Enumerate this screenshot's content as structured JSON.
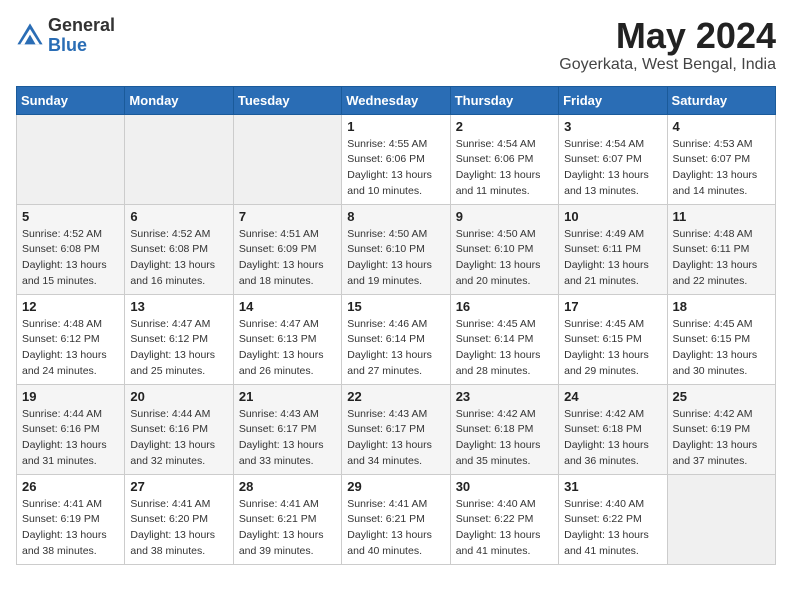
{
  "header": {
    "logo_general": "General",
    "logo_blue": "Blue",
    "month_year": "May 2024",
    "location": "Goyerkata, West Bengal, India"
  },
  "days_of_week": [
    "Sunday",
    "Monday",
    "Tuesday",
    "Wednesday",
    "Thursday",
    "Friday",
    "Saturday"
  ],
  "weeks": [
    {
      "days": [
        {
          "number": "",
          "sunrise": "",
          "sunset": "",
          "daylight": ""
        },
        {
          "number": "",
          "sunrise": "",
          "sunset": "",
          "daylight": ""
        },
        {
          "number": "",
          "sunrise": "",
          "sunset": "",
          "daylight": ""
        },
        {
          "number": "1",
          "sunrise": "Sunrise: 4:55 AM",
          "sunset": "Sunset: 6:06 PM",
          "daylight": "Daylight: 13 hours and 10 minutes."
        },
        {
          "number": "2",
          "sunrise": "Sunrise: 4:54 AM",
          "sunset": "Sunset: 6:06 PM",
          "daylight": "Daylight: 13 hours and 11 minutes."
        },
        {
          "number": "3",
          "sunrise": "Sunrise: 4:54 AM",
          "sunset": "Sunset: 6:07 PM",
          "daylight": "Daylight: 13 hours and 13 minutes."
        },
        {
          "number": "4",
          "sunrise": "Sunrise: 4:53 AM",
          "sunset": "Sunset: 6:07 PM",
          "daylight": "Daylight: 13 hours and 14 minutes."
        }
      ]
    },
    {
      "days": [
        {
          "number": "5",
          "sunrise": "Sunrise: 4:52 AM",
          "sunset": "Sunset: 6:08 PM",
          "daylight": "Daylight: 13 hours and 15 minutes."
        },
        {
          "number": "6",
          "sunrise": "Sunrise: 4:52 AM",
          "sunset": "Sunset: 6:08 PM",
          "daylight": "Daylight: 13 hours and 16 minutes."
        },
        {
          "number": "7",
          "sunrise": "Sunrise: 4:51 AM",
          "sunset": "Sunset: 6:09 PM",
          "daylight": "Daylight: 13 hours and 18 minutes."
        },
        {
          "number": "8",
          "sunrise": "Sunrise: 4:50 AM",
          "sunset": "Sunset: 6:10 PM",
          "daylight": "Daylight: 13 hours and 19 minutes."
        },
        {
          "number": "9",
          "sunrise": "Sunrise: 4:50 AM",
          "sunset": "Sunset: 6:10 PM",
          "daylight": "Daylight: 13 hours and 20 minutes."
        },
        {
          "number": "10",
          "sunrise": "Sunrise: 4:49 AM",
          "sunset": "Sunset: 6:11 PM",
          "daylight": "Daylight: 13 hours and 21 minutes."
        },
        {
          "number": "11",
          "sunrise": "Sunrise: 4:48 AM",
          "sunset": "Sunset: 6:11 PM",
          "daylight": "Daylight: 13 hours and 22 minutes."
        }
      ]
    },
    {
      "days": [
        {
          "number": "12",
          "sunrise": "Sunrise: 4:48 AM",
          "sunset": "Sunset: 6:12 PM",
          "daylight": "Daylight: 13 hours and 24 minutes."
        },
        {
          "number": "13",
          "sunrise": "Sunrise: 4:47 AM",
          "sunset": "Sunset: 6:12 PM",
          "daylight": "Daylight: 13 hours and 25 minutes."
        },
        {
          "number": "14",
          "sunrise": "Sunrise: 4:47 AM",
          "sunset": "Sunset: 6:13 PM",
          "daylight": "Daylight: 13 hours and 26 minutes."
        },
        {
          "number": "15",
          "sunrise": "Sunrise: 4:46 AM",
          "sunset": "Sunset: 6:14 PM",
          "daylight": "Daylight: 13 hours and 27 minutes."
        },
        {
          "number": "16",
          "sunrise": "Sunrise: 4:45 AM",
          "sunset": "Sunset: 6:14 PM",
          "daylight": "Daylight: 13 hours and 28 minutes."
        },
        {
          "number": "17",
          "sunrise": "Sunrise: 4:45 AM",
          "sunset": "Sunset: 6:15 PM",
          "daylight": "Daylight: 13 hours and 29 minutes."
        },
        {
          "number": "18",
          "sunrise": "Sunrise: 4:45 AM",
          "sunset": "Sunset: 6:15 PM",
          "daylight": "Daylight: 13 hours and 30 minutes."
        }
      ]
    },
    {
      "days": [
        {
          "number": "19",
          "sunrise": "Sunrise: 4:44 AM",
          "sunset": "Sunset: 6:16 PM",
          "daylight": "Daylight: 13 hours and 31 minutes."
        },
        {
          "number": "20",
          "sunrise": "Sunrise: 4:44 AM",
          "sunset": "Sunset: 6:16 PM",
          "daylight": "Daylight: 13 hours and 32 minutes."
        },
        {
          "number": "21",
          "sunrise": "Sunrise: 4:43 AM",
          "sunset": "Sunset: 6:17 PM",
          "daylight": "Daylight: 13 hours and 33 minutes."
        },
        {
          "number": "22",
          "sunrise": "Sunrise: 4:43 AM",
          "sunset": "Sunset: 6:17 PM",
          "daylight": "Daylight: 13 hours and 34 minutes."
        },
        {
          "number": "23",
          "sunrise": "Sunrise: 4:42 AM",
          "sunset": "Sunset: 6:18 PM",
          "daylight": "Daylight: 13 hours and 35 minutes."
        },
        {
          "number": "24",
          "sunrise": "Sunrise: 4:42 AM",
          "sunset": "Sunset: 6:18 PM",
          "daylight": "Daylight: 13 hours and 36 minutes."
        },
        {
          "number": "25",
          "sunrise": "Sunrise: 4:42 AM",
          "sunset": "Sunset: 6:19 PM",
          "daylight": "Daylight: 13 hours and 37 minutes."
        }
      ]
    },
    {
      "days": [
        {
          "number": "26",
          "sunrise": "Sunrise: 4:41 AM",
          "sunset": "Sunset: 6:19 PM",
          "daylight": "Daylight: 13 hours and 38 minutes."
        },
        {
          "number": "27",
          "sunrise": "Sunrise: 4:41 AM",
          "sunset": "Sunset: 6:20 PM",
          "daylight": "Daylight: 13 hours and 38 minutes."
        },
        {
          "number": "28",
          "sunrise": "Sunrise: 4:41 AM",
          "sunset": "Sunset: 6:21 PM",
          "daylight": "Daylight: 13 hours and 39 minutes."
        },
        {
          "number": "29",
          "sunrise": "Sunrise: 4:41 AM",
          "sunset": "Sunset: 6:21 PM",
          "daylight": "Daylight: 13 hours and 40 minutes."
        },
        {
          "number": "30",
          "sunrise": "Sunrise: 4:40 AM",
          "sunset": "Sunset: 6:22 PM",
          "daylight": "Daylight: 13 hours and 41 minutes."
        },
        {
          "number": "31",
          "sunrise": "Sunrise: 4:40 AM",
          "sunset": "Sunset: 6:22 PM",
          "daylight": "Daylight: 13 hours and 41 minutes."
        },
        {
          "number": "",
          "sunrise": "",
          "sunset": "",
          "daylight": ""
        }
      ]
    }
  ]
}
